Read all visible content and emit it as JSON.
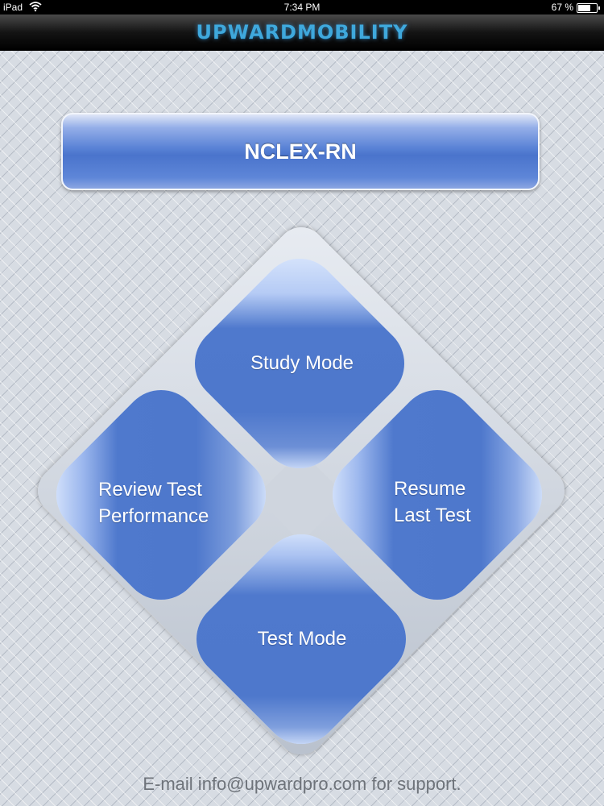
{
  "status_bar": {
    "carrier": "iPad",
    "time": "7:34 PM",
    "battery_percent": "67 %",
    "battery_level": 0.67,
    "wifi_icon": "wifi-icon"
  },
  "nav_bar": {
    "logo_text": "UPWARDMOBILITY"
  },
  "title": "NCLEX-RN",
  "menu": {
    "study_mode": "Study Mode",
    "review_test_line1": "Review Test",
    "review_test_line2": "Performance",
    "resume_line1": "Resume",
    "resume_line2": "Last Test",
    "test_mode": "Test Mode"
  },
  "support_text": "E-mail info@upwardpro.com for support.",
  "colors": {
    "accent_blue": "#4e78cc",
    "light_blue": "#d8e5fc",
    "logo_blue": "#3fa8dc"
  }
}
